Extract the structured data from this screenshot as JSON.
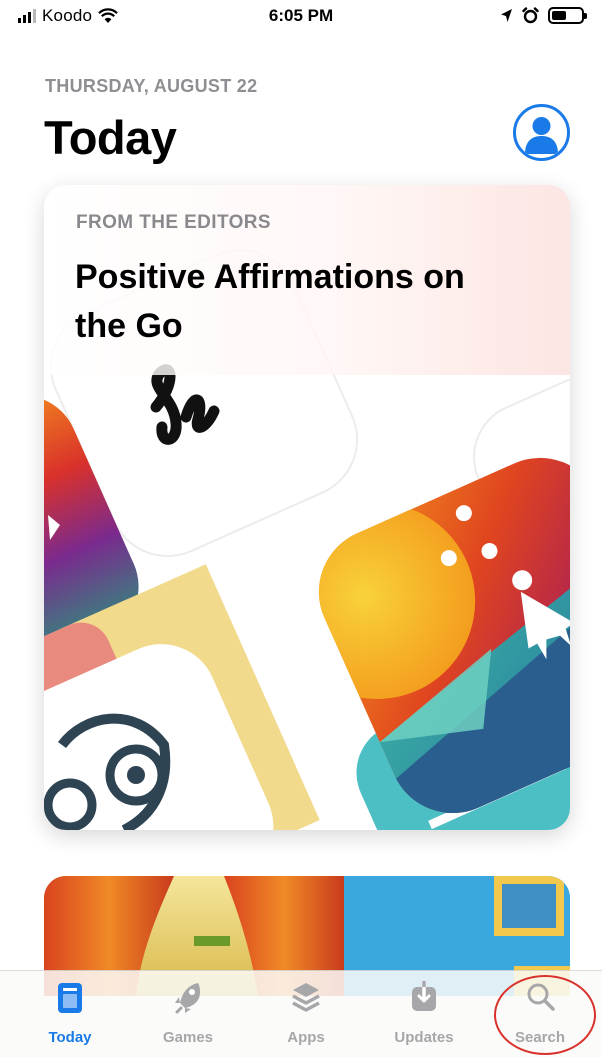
{
  "status_bar": {
    "carrier": "Koodo",
    "time": "6:05 PM",
    "battery_level": 0.5
  },
  "header": {
    "date": "THURSDAY, AUGUST 22",
    "title": "Today",
    "avatar_icon": "person-icon"
  },
  "featured_card": {
    "eyebrow": "FROM THE EDITORS",
    "title": "Positive Affirmations on the Go"
  },
  "tab_bar": {
    "tabs": [
      {
        "label": "Today",
        "icon": "today-icon",
        "active": true
      },
      {
        "label": "Games",
        "icon": "rocket-icon",
        "active": false
      },
      {
        "label": "Apps",
        "icon": "layers-icon",
        "active": false
      },
      {
        "label": "Updates",
        "icon": "download-icon",
        "active": false
      },
      {
        "label": "Search",
        "icon": "search-icon",
        "active": false
      }
    ]
  },
  "colors": {
    "accent": "#1a7be8",
    "highlight_circle": "#d9312b",
    "inactive_tab": "#a7a7aa"
  }
}
